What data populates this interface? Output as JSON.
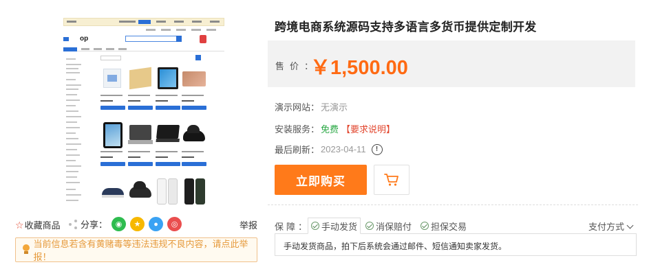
{
  "product": {
    "title": "跨境电商系统源码支持多语言多货币提供定制开发",
    "price_label": "售价：",
    "price": "￥1,500.00",
    "demo_site_label": "演示网站：",
    "demo_site_value": "无演示",
    "install_label": "安装服务：",
    "install_value": "免费",
    "install_note": "【要求说明】",
    "refresh_label": "最后刷新：",
    "refresh_date": "2023-04-11",
    "refresh_icon": "clock-icon",
    "buy_label": "立即购买",
    "cart_icon": "cart-icon"
  },
  "actions": {
    "favorite_label": "收藏商品",
    "share_label": "分享：",
    "share_icons": [
      "wechat-icon",
      "qzone-icon",
      "qq-icon",
      "weibo-icon"
    ],
    "report_label": "举报"
  },
  "warning": {
    "text": "当前信息若含有黄赌毒等违法违规不良内容，请点此举报！"
  },
  "guarantee": {
    "label": "保障：",
    "tabs": [
      "手动发货",
      "消保赔付",
      "担保交易"
    ],
    "active_tab": 0,
    "payment_label": "支付方式",
    "description": "手动发货商品，拍下后系统会通过邮件、短信通知卖家发货。"
  },
  "colors": {
    "accent_orange": "#ff7a1a",
    "price_orange": "#ff6a13",
    "free_green": "#2aa845",
    "note_red": "#e2472f",
    "warning_text": "#e69a3c"
  }
}
